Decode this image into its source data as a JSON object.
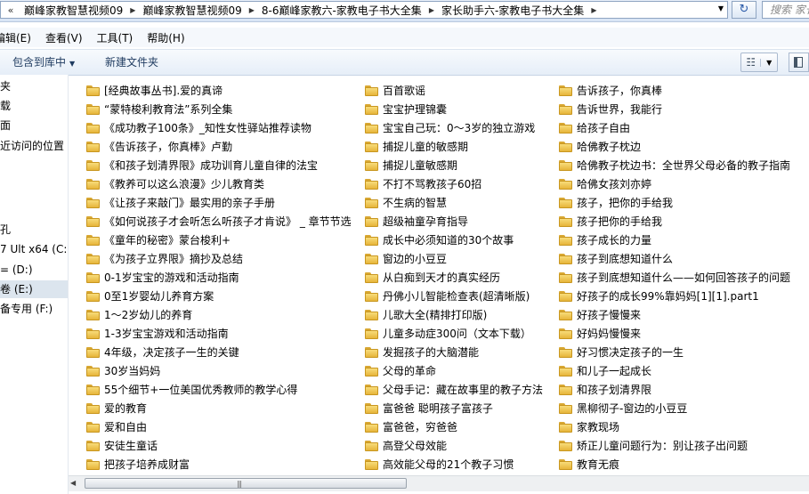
{
  "address": {
    "back": "«",
    "crumbs": [
      "巅峰家教智慧视频09",
      "巅峰家教智慧视频09",
      "8-6巅峰家教六-家教电子书大全集",
      "家长助手六-家教电子书大全集"
    ],
    "search_placeholder": "搜索 家长"
  },
  "menu": [
    "编辑(E)",
    "查看(V)",
    "工具(T)",
    "帮助(H)"
  ],
  "toolbar": {
    "include_label": "包含到库中",
    "new_folder_label": "新建文件夹"
  },
  "nav": [
    {
      "label": "夹"
    },
    {
      "label": "载"
    },
    {
      "label": "面"
    },
    {
      "label": "近访问的位置"
    },
    {
      "label": "孔"
    },
    {
      "label": "7 Ult x64 (C:"
    },
    {
      "label": "= (D:)"
    },
    {
      "label": "卷 (E:)",
      "selected": true
    },
    {
      "label": "备专用 (F:)"
    }
  ],
  "columns": [
    [
      "[经典故事丛书].爱的真谛",
      "“蒙特梭利教育法”系列全集",
      "《成功教子100条》_知性女性驿站推荐读物",
      "《告诉孩子，你真棒》卢勤",
      "《和孩子划清界限》成功训育儿童自律的法宝",
      "《教养可以这么浪漫》少儿教育类",
      "《让孩子来敲门》最实用的亲子手册",
      "《如何说孩子才会听怎么听孩子才肯说》 _ 章节节选",
      "《童年的秘密》蒙台梭利+",
      "《为孩子立界限》摘抄及总结",
      "0-1岁宝宝的游戏和活动指南",
      "0至1岁婴幼儿养育方案",
      "1～2岁幼儿的养育",
      "1-3岁宝宝游戏和活动指南",
      "4年级，决定孩子一生的关键",
      "30岁当妈妈",
      "55个细节+一位美国优秀教师的教学心得",
      "爱的教育",
      "爱和自由",
      "安徒生童话",
      "把孩子培养成财富"
    ],
    [
      "百首歌谣",
      "宝宝护理锦囊",
      "宝宝自己玩：0～3岁的独立游戏",
      "捕捉儿童的敏感期",
      "捕捉儿童敏感期",
      "不打不骂教孩子60招",
      "不生病的智慧",
      "超级袖童孕育指导",
      "成长中必须知道的30个故事",
      "窗边的小豆豆",
      "从白痴到天才的真实经历",
      "丹佛小儿智能检查表(超清晰版)",
      "儿歌大全(精排打印版)",
      "儿童多动症300问（文本下载）",
      "发掘孩子的大脑潜能",
      "父母的革命",
      "父母手记：藏在故事里的教子方法",
      "富爸爸 聪明孩子富孩子",
      "富爸爸，穷爸爸",
      "高登父母效能",
      "高效能父母的21个教子习惯"
    ],
    [
      "告诉孩子，你真棒",
      "告诉世界，我能行",
      "给孩子自由",
      "哈佛教子枕边",
      "哈佛教子枕边书：全世界父母必备的教子指南",
      "哈佛女孩刘亦婷",
      "孩子，把你的手给我",
      "孩子把你的手给我",
      "孩子成长的力量",
      "孩子到底想知道什么",
      "孩子到底想知道什么——如何回答孩子的问题",
      "好孩子的成长99%靠妈妈[1][1].part1",
      "好孩子慢慢来",
      "好妈妈慢慢来",
      "好习惯决定孩子的一生",
      "和儿子一起成长",
      "和孩子划清界限",
      "黑柳彻子-窗边的小豆豆",
      "家教现场",
      "矫正儿童问题行为：别让孩子出问题",
      "教育无痕"
    ]
  ]
}
